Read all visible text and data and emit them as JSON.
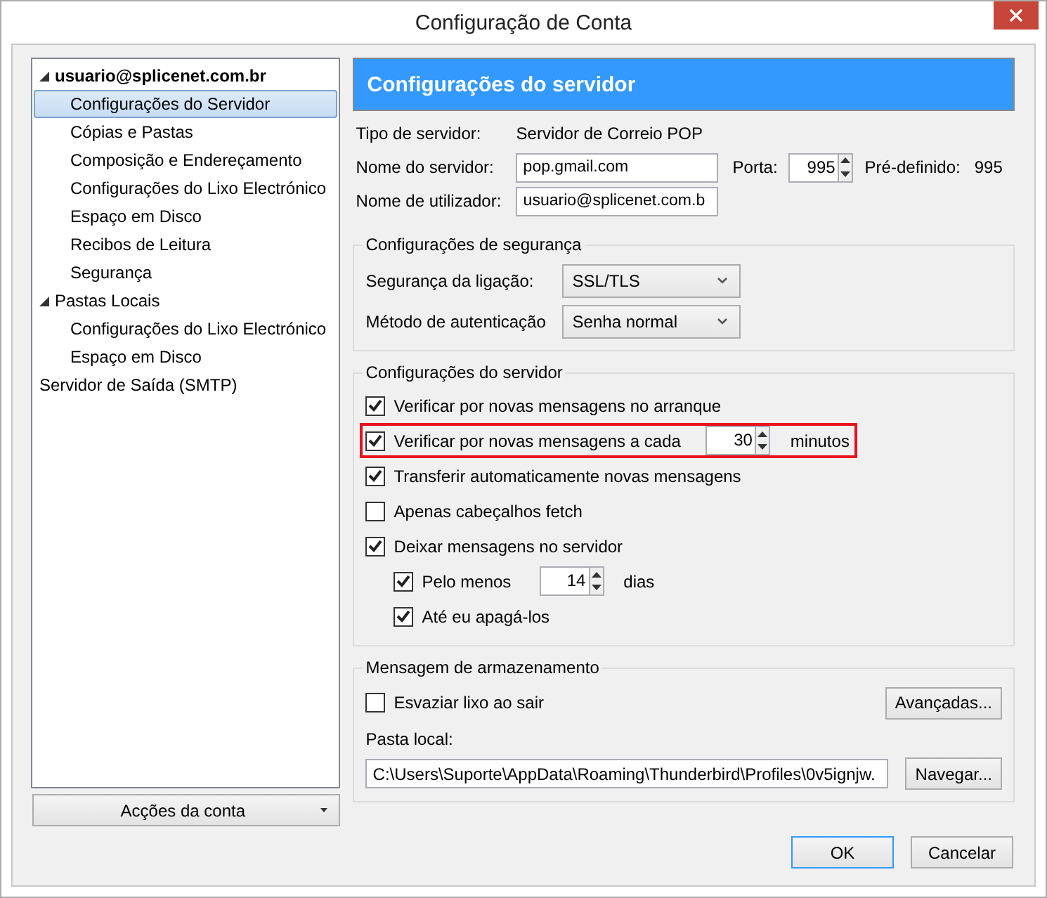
{
  "window": {
    "title": "Configuração de Conta"
  },
  "tree": [
    {
      "label": "usuario@splicenet.com.br",
      "bold": true,
      "expanded": true,
      "selected": false,
      "children": [
        {
          "label": "Configurações do Servidor",
          "selected": true
        },
        {
          "label": "Cópias e Pastas",
          "selected": false
        },
        {
          "label": "Composição e Endereçamento",
          "selected": false
        },
        {
          "label": "Configurações do Lixo Electrónico",
          "selected": false
        },
        {
          "label": "Espaço em Disco",
          "selected": false
        },
        {
          "label": "Recibos de Leitura",
          "selected": false
        },
        {
          "label": "Segurança",
          "selected": false
        }
      ]
    },
    {
      "label": "Pastas Locais",
      "bold": false,
      "expanded": true,
      "selected": false,
      "children": [
        {
          "label": "Configurações do Lixo Electrónico",
          "selected": false
        },
        {
          "label": "Espaço em Disco",
          "selected": false
        }
      ]
    },
    {
      "label": "Servidor de Saída (SMTP)",
      "bold": false,
      "selected": false
    }
  ],
  "account_actions": {
    "label": "Acções da conta"
  },
  "header": "Configurações do servidor",
  "server_type": {
    "label": "Tipo de servidor:",
    "value": "Servidor de Correio POP"
  },
  "server_name": {
    "label": "Nome do servidor:",
    "value": "pop.gmail.com"
  },
  "port": {
    "label": "Porta:",
    "value": "995"
  },
  "default_port": {
    "label": "Pré-definido:",
    "value": "995"
  },
  "username": {
    "label": "Nome de utilizador:",
    "value": "usuario@splicenet.com.b"
  },
  "security": {
    "title": "Configurações de segurança",
    "fields": [
      {
        "label": "Segurança da ligação:",
        "value": "SSL/TLS"
      },
      {
        "label": "Método de autenticação",
        "value": "Senha normal"
      }
    ]
  },
  "server_settings": {
    "title": "Configurações do servidor",
    "options": [
      {
        "kind": "checkbox",
        "label": "Verificar por novas mensagens no arranque",
        "checked": true,
        "highlighted": false
      },
      {
        "kind": "interval",
        "label": "Verificar por novas mensagens a cada",
        "checked": true,
        "highlighted": true,
        "value": "30",
        "unit": "minutos"
      },
      {
        "kind": "checkbox",
        "label": "Transferir automaticamente novas mensagens",
        "checked": true,
        "highlighted": false
      },
      {
        "kind": "checkbox",
        "label": "Apenas cabeçalhos fetch",
        "checked": false,
        "highlighted": false
      },
      {
        "kind": "checkbox",
        "label": "Deixar mensagens no servidor",
        "checked": true,
        "highlighted": false,
        "children": [
          {
            "kind": "interval",
            "label": "Pelo menos",
            "checked": true,
            "highlighted": false,
            "value": "14",
            "unit": "dias"
          },
          {
            "kind": "checkbox",
            "label": "Até eu apagá-los",
            "checked": true,
            "highlighted": false
          }
        ]
      }
    ]
  },
  "storage": {
    "title": "Mensagem de armazenamento",
    "empty_trash": {
      "label": "Esvaziar lixo ao sair",
      "checked": false
    },
    "advanced_button": "Avançadas...",
    "local_folder_label": "Pasta local:",
    "local_folder_value": "C:\\Users\\Suporte\\AppData\\Roaming\\Thunderbird\\Profiles\\0v5ignjw.",
    "browse_button": "Navegar..."
  },
  "buttons": [
    {
      "label": "OK",
      "selected": true
    },
    {
      "label": "Cancelar",
      "selected": false
    }
  ]
}
